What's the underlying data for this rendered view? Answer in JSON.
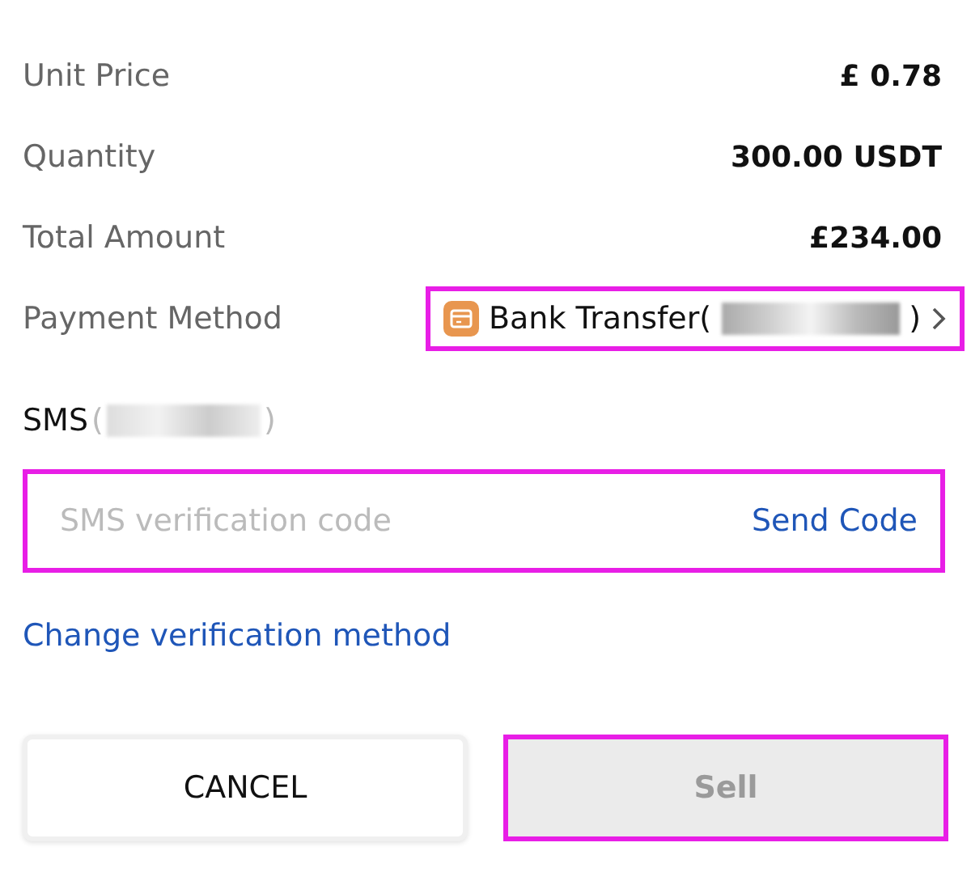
{
  "details": [
    {
      "label": "Unit Price",
      "value": "£ 0.78"
    },
    {
      "label": "Quantity",
      "value": "300.00 USDT"
    },
    {
      "label": "Total Amount",
      "value": "£234.00"
    }
  ],
  "payment": {
    "label": "Payment Method",
    "method_prefix": "Bank Transfer(",
    "method_suffix": ")",
    "highlighted": true
  },
  "sms": {
    "label": "SMS",
    "open": "(",
    "close": ")",
    "placeholder": "SMS verification code",
    "send": "Send Code",
    "highlighted": true
  },
  "change_link": "Change verification method",
  "buttons": [
    {
      "label": "CANCEL",
      "kind": "secondary",
      "disabled": false,
      "highlighted": false
    },
    {
      "label": "Sell",
      "kind": "primary",
      "disabled": true,
      "highlighted": true
    }
  ]
}
